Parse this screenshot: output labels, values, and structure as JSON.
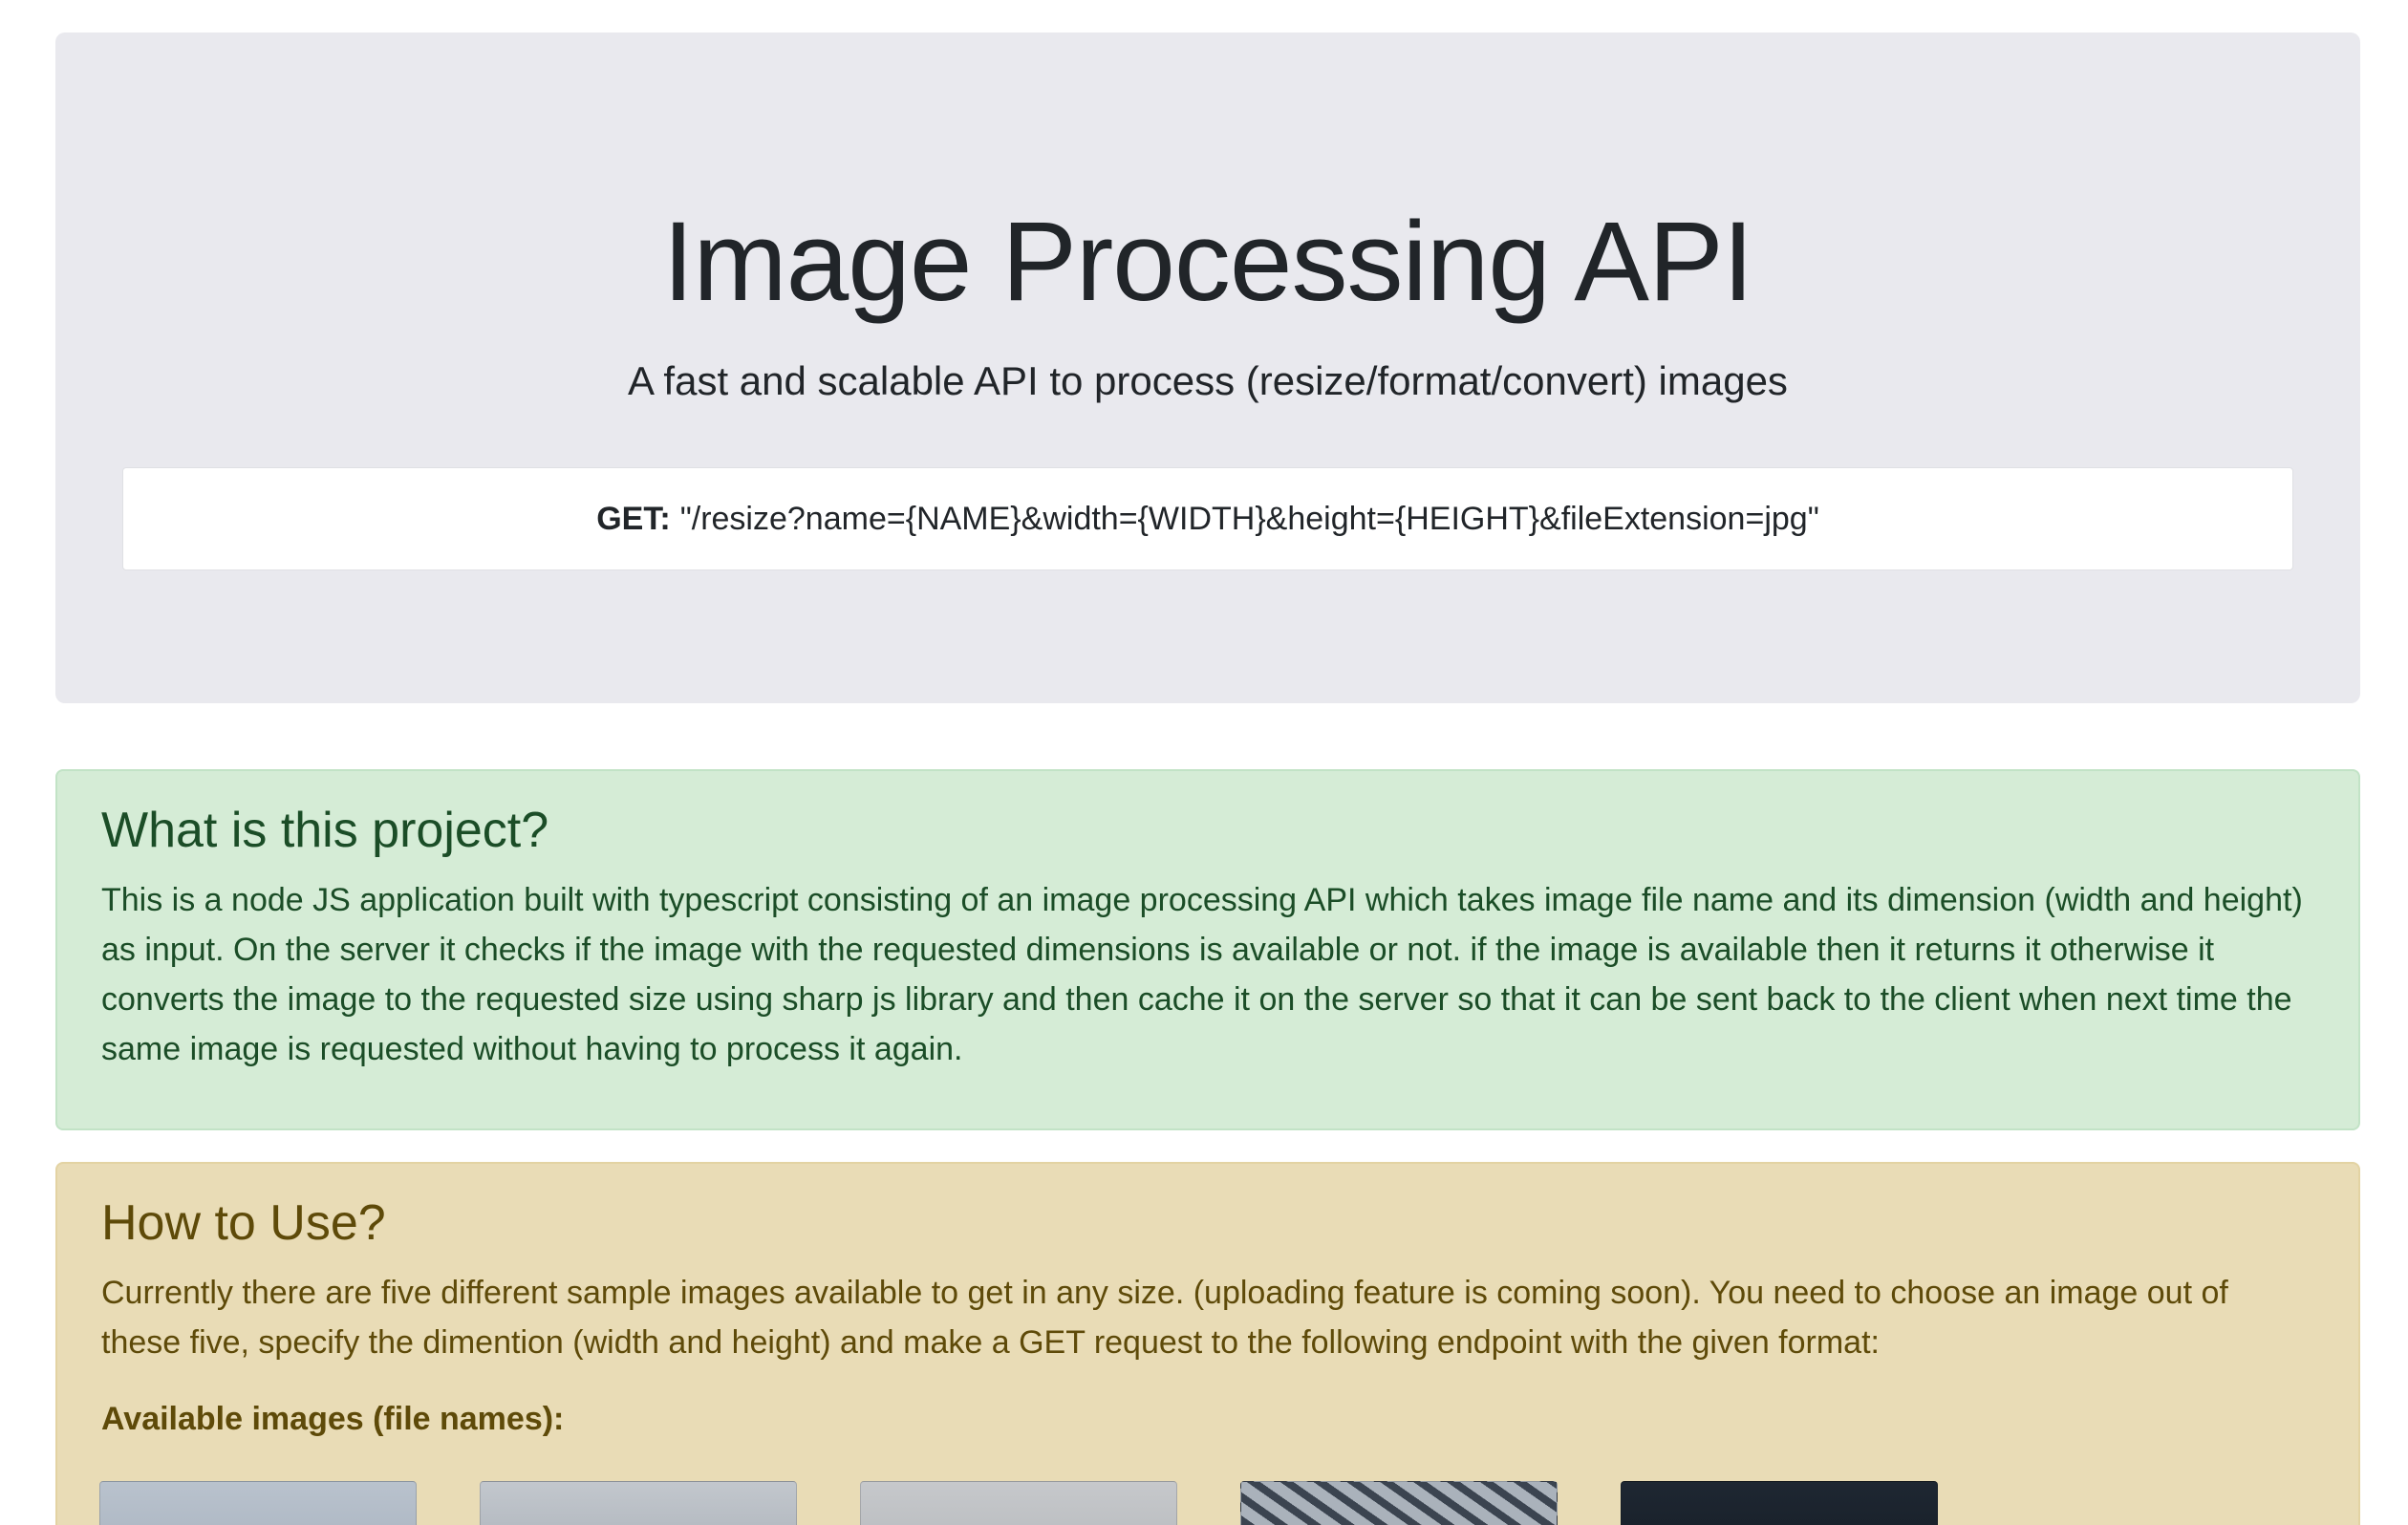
{
  "header": {
    "title": "Image Processing API",
    "subtitle": "A fast and scalable API to process (resize/format/convert) images",
    "endpoint": {
      "method": "GET:",
      "path": "\"/resize?name={NAME}&width={WIDTH}&height={HEIGHT}&fileExtension=jpg\""
    }
  },
  "about": {
    "heading": "What is this project?",
    "body": "This is a node JS application built with typescript consisting of an image processing API which takes image file name and its dimension (width and height) as input. On the server it checks if the image with the requested dimensions is available or not. if the image is available then it returns it otherwise it converts the image to the requested size using sharp js library and then cache it on the server so that it can be sent back to the client when next time the same image is requested without having to process it again."
  },
  "usage": {
    "heading": "How to Use?",
    "body": "Currently there are five different sample images available to get in any size. (uploading feature is coming soon). You need to choose an image out of these five, specify the dimention (width and height) and make a GET request to the following endpoint with the given format:",
    "available_label": "Available images (file names):",
    "thumbnails_count": 5
  },
  "colors": {
    "jumbotron_bg": "#e9e9ee",
    "success_bg": "#d5ecd6",
    "warning_bg": "#e9dcb6"
  }
}
